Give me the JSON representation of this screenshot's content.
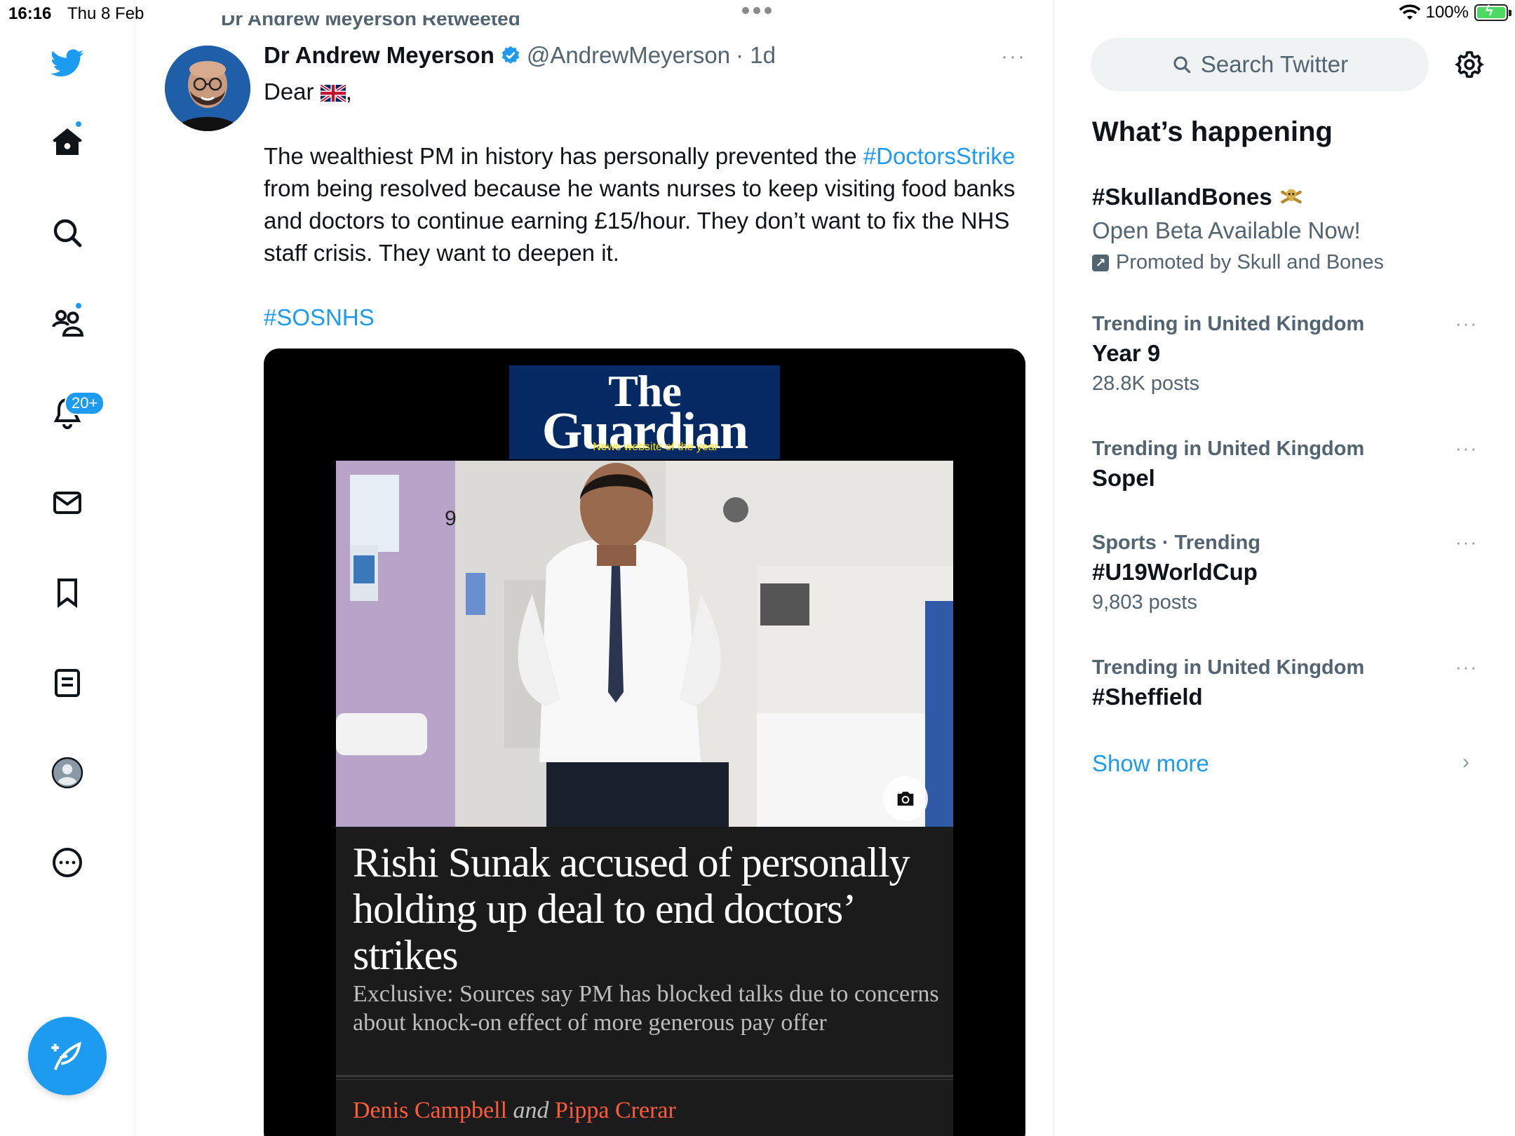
{
  "status_bar": {
    "time": "16:16",
    "date": "Thu 8 Feb",
    "battery": "100%"
  },
  "nav": {
    "notifications_badge": "20+",
    "accent": "#1d9bf0"
  },
  "tweet": {
    "retweeted_by": "Dr Andrew Meyerson Retweeted",
    "author_name": "Dr Andrew Meyerson",
    "handle": "@AndrewMeyerson",
    "time": "· 1d",
    "more": "···",
    "greeting": "Dear",
    "greeting_suffix": ",",
    "para_1a": "The wealthiest PM in history has personally prevented the ",
    "hashtag_1": "#DoctorsStrike",
    "para_1b": " from being resolved because he wants nurses to keep visiting food banks and doctors to continue earning £15/hour. They don’t want to fix the NHS staff crisis. They want to deepen it.",
    "hashtag_2": "#SOSNHS"
  },
  "media": {
    "logo_the": "The",
    "logo_guardian": "Guardian",
    "logo_tagline": "News website of the year",
    "photo_number": "9",
    "headline": "Rishi Sunak accused of personally holding up deal to end doctors’ strikes",
    "standfirst": "Exclusive: Sources say PM has blocked talks due to concerns about knock-on effect of more generous pay offer",
    "author_1": "Denis Campbell",
    "and": "and",
    "author_2": "Pippa Crerar"
  },
  "sidebar": {
    "search_placeholder": "Search Twitter",
    "whats_happening": "What’s happening",
    "promoted": {
      "name": "#SkullandBones",
      "subtitle": "Open Beta Available Now!",
      "by": "Promoted by Skull and Bones"
    },
    "trends": [
      {
        "category": "Trending in United Kingdom",
        "name": "Year 9",
        "count": "28.8K posts"
      },
      {
        "category": "Trending in United Kingdom",
        "name": "Sopel",
        "count": ""
      },
      {
        "category": "Sports · Trending",
        "name": "#U19WorldCup",
        "count": "9,803 posts"
      },
      {
        "category": "Trending in United Kingdom",
        "name": "#Sheffield",
        "count": ""
      }
    ],
    "more_dots": "···",
    "show_more": "Show more"
  }
}
